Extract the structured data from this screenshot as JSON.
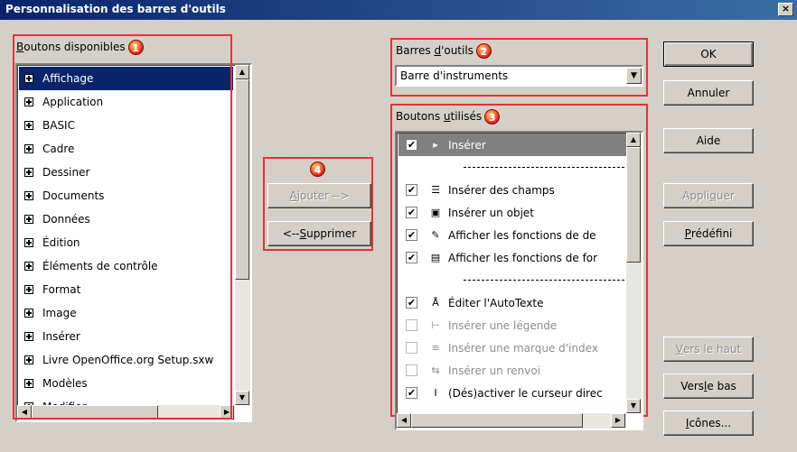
{
  "window": {
    "title": "Personnalisation des barres d'outils",
    "close_glyph": "×"
  },
  "available": {
    "label_prefix": "B",
    "label_rest": "outons disponibles",
    "badge": "1",
    "items": [
      {
        "label": "Affichage",
        "selected": true
      },
      {
        "label": "Application"
      },
      {
        "label": "BASIC"
      },
      {
        "label": "Cadre"
      },
      {
        "label": "Dessiner"
      },
      {
        "label": "Documents"
      },
      {
        "label": "Données"
      },
      {
        "label": "Édition"
      },
      {
        "label": "Éléments de contrôle"
      },
      {
        "label": "Format"
      },
      {
        "label": "Image"
      },
      {
        "label": "Insérer"
      },
      {
        "label": "Livre OpenOffice.org Setup.sxw"
      },
      {
        "label": "Modèles"
      },
      {
        "label": "Modifier"
      }
    ]
  },
  "toolbars": {
    "label_a": "Barres ",
    "label_u": "d",
    "label_b": "'outils",
    "badge": "2",
    "selected": "Barre d'instruments"
  },
  "used": {
    "label_a": "Boutons ",
    "label_u": "u",
    "label_b": "tilisés",
    "badge": "3",
    "items": [
      {
        "label": "Insérer",
        "checked": true,
        "selected": true,
        "icon": "insert-frame-icon"
      },
      {
        "separator": true
      },
      {
        "label": "Insérer des champs",
        "checked": true,
        "icon": "insert-fields-icon"
      },
      {
        "label": "Insérer un objet",
        "checked": true,
        "icon": "insert-object-icon"
      },
      {
        "label": "Afficher les fonctions de de",
        "checked": true,
        "icon": "draw-functions-icon"
      },
      {
        "label": "Afficher les fonctions de for",
        "checked": true,
        "icon": "form-functions-icon"
      },
      {
        "separator": true
      },
      {
        "label": "Éditer l'AutoTexte",
        "checked": true,
        "icon": "autotext-icon"
      },
      {
        "label": "Insérer une légende",
        "checked": false,
        "icon": "caption-icon"
      },
      {
        "label": "Insérer une marque d'index",
        "checked": false,
        "icon": "index-mark-icon"
      },
      {
        "label": "Insérer un renvoi",
        "checked": false,
        "icon": "cross-reference-icon"
      },
      {
        "label": "(Dés)activer le curseur direc",
        "checked": true,
        "icon": "direct-cursor-icon"
      }
    ]
  },
  "middle": {
    "badge": "4",
    "add_u": "A",
    "add_rest": "jouter -->",
    "remove_a": "<-- ",
    "remove_u": "S",
    "remove_b": "upprimer"
  },
  "buttons": {
    "ok": "OK",
    "cancel": "Annuler",
    "help": "Aide",
    "apply_a": "Appli",
    "apply_u": "q",
    "apply_b": "uer",
    "predefined_u": "P",
    "predefined_rest": "rédéfini",
    "up_u": "V",
    "up_rest": "ers le haut",
    "down_a": "Vers ",
    "down_u": "l",
    "down_b": "e bas",
    "icons_u": "I",
    "icons_rest": "cônes..."
  },
  "colors": {
    "highlight": "#e8313a",
    "selection": "#0a246a",
    "face": "#d4d0c8"
  }
}
